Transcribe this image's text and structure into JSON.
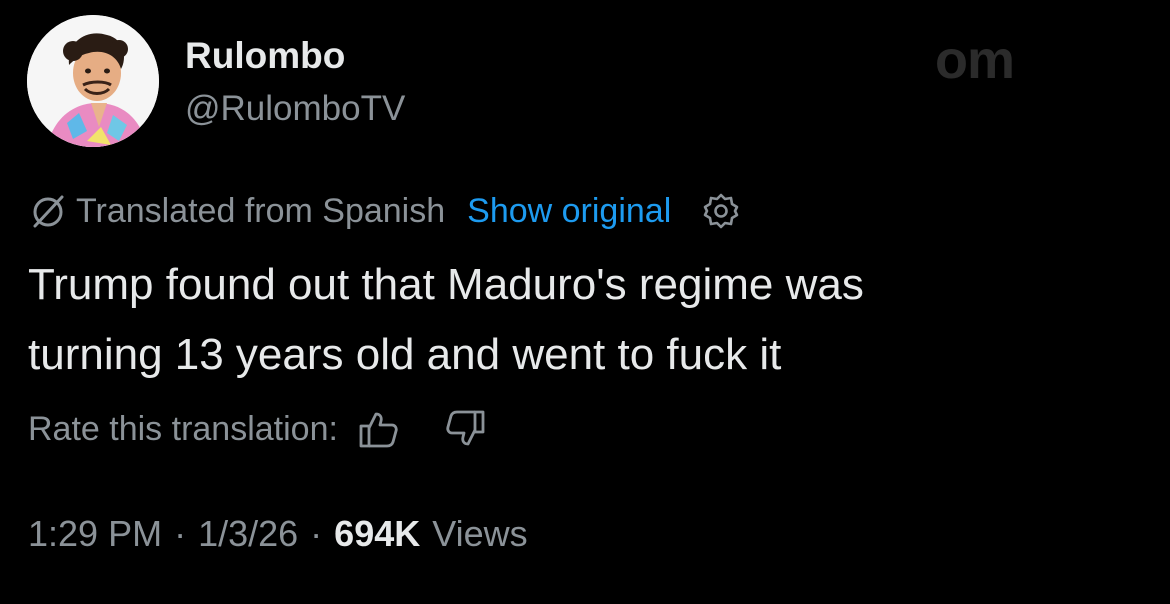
{
  "author": {
    "display_name": "Rulombo",
    "handle": "@RulomboTV"
  },
  "watermark": "om",
  "translation": {
    "label": "Translated from Spanish",
    "show_original": "Show original",
    "icons": [
      "globe-slash-icon",
      "gear-icon"
    ]
  },
  "tweet": {
    "line1": "Trump found out that Maduro's regime was",
    "line2": "turning 13 years old and went to fuck it"
  },
  "rating": {
    "label": "Rate this translation:",
    "icons": [
      "thumbs-up-icon",
      "thumbs-down-icon"
    ]
  },
  "meta": {
    "time": "1:29 PM",
    "date": "1/3/26",
    "separator": "·",
    "views_count": "694K",
    "views_label": "Views"
  },
  "colors": {
    "background": "#000000",
    "text": "#e7e9ea",
    "secondary": "#8b9298",
    "link": "#1d9bf0"
  }
}
